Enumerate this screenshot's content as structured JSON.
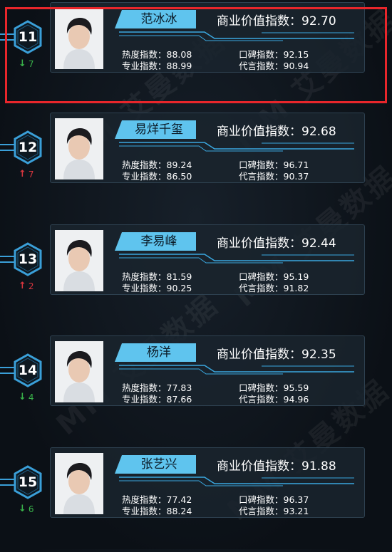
{
  "value_label": "商业价值指数",
  "stat_labels": {
    "heat": "热度指数",
    "professional": "专业指数",
    "reputation": "口碑指数",
    "endorsement": "代言指数"
  },
  "watermark": "MM 艾曼数据",
  "colors": {
    "accent": "#5fc4ee",
    "up": "#d9363e",
    "down": "#39b24a",
    "highlight": "#e8262b"
  },
  "rows": [
    {
      "rank": "11",
      "direction": "down",
      "change": "7",
      "name": "范冰冰",
      "score": "92.70",
      "heat": "88.08",
      "professional": "88.99",
      "reputation": "92.15",
      "endorsement": "90.94",
      "highlighted": true
    },
    {
      "rank": "12",
      "direction": "up",
      "change": "7",
      "name": "易烊千玺",
      "score": "92.68",
      "heat": "89.24",
      "professional": "86.50",
      "reputation": "96.71",
      "endorsement": "90.37",
      "highlighted": false
    },
    {
      "rank": "13",
      "direction": "up",
      "change": "2",
      "name": "李易峰",
      "score": "92.44",
      "heat": "81.59",
      "professional": "90.25",
      "reputation": "95.19",
      "endorsement": "91.82",
      "highlighted": false
    },
    {
      "rank": "14",
      "direction": "down",
      "change": "4",
      "name": "杨洋",
      "score": "92.35",
      "heat": "77.83",
      "professional": "87.66",
      "reputation": "95.59",
      "endorsement": "94.96",
      "highlighted": false
    },
    {
      "rank": "15",
      "direction": "down",
      "change": "6",
      "name": "张艺兴",
      "score": "91.88",
      "heat": "77.42",
      "professional": "88.24",
      "reputation": "96.37",
      "endorsement": "93.21",
      "highlighted": false
    }
  ]
}
